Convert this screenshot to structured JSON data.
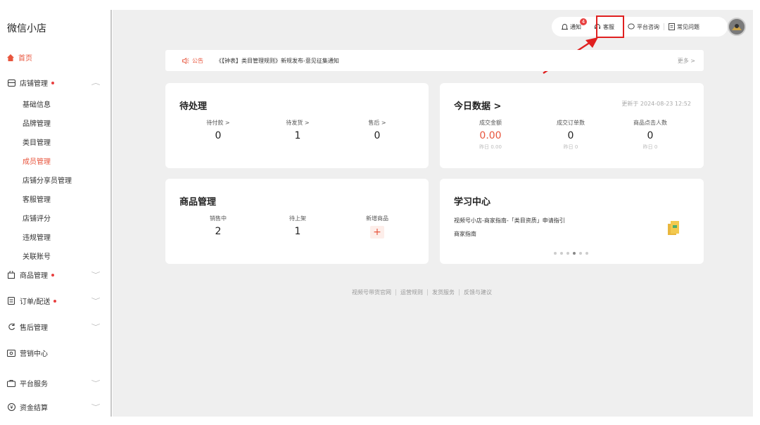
{
  "sidebar": {
    "brand": "微信小店",
    "home": "首页",
    "store_group": "店铺管理",
    "store_items": [
      "基础信息",
      "品牌管理",
      "类目管理",
      "成员管理",
      "店铺分享员管理",
      "客服管理",
      "店铺评分",
      "违规管理",
      "关联账号"
    ],
    "groups": {
      "goods": "商品管理",
      "orders": "订单/配送",
      "aftersale": "售后管理",
      "marketing": "营销中心",
      "platform": "平台服务",
      "finance": "资金结算"
    }
  },
  "topbar": {
    "notify": "通知",
    "notify_badge": "4",
    "service": "客服",
    "consult": "平台咨询",
    "faq": "常见问题"
  },
  "notice": {
    "label": "公告",
    "text": "《【钟表】类目管理规则》新规发布-意见征集通知",
    "more": "更多 >"
  },
  "pending": {
    "title": "待处理",
    "items": [
      {
        "label": "待付款 >",
        "value": "0"
      },
      {
        "label": "待发货 >",
        "value": "1"
      },
      {
        "label": "售后 >",
        "value": "0"
      }
    ]
  },
  "today": {
    "title": "今日数据 >",
    "updated": "更新于 2024-08-23 12:52",
    "items": [
      {
        "label": "成交金额",
        "value": "0.00",
        "sub": "昨日 0.00"
      },
      {
        "label": "成交订单数",
        "value": "0",
        "sub": "昨日 0"
      },
      {
        "label": "商品点击人数",
        "value": "0",
        "sub": "昨日 0"
      }
    ]
  },
  "goods": {
    "title": "商品管理",
    "items": [
      {
        "label": "销售中",
        "value": "2"
      },
      {
        "label": "待上架",
        "value": "1"
      },
      {
        "label": "新增商品",
        "value": "+"
      }
    ]
  },
  "learning": {
    "title": "学习中心",
    "line1": "视频号小店-商家指南-「类目资质」申请指引",
    "line2": "商家指南"
  },
  "footer": [
    "视频号带货官网",
    "运营规则",
    "发货服务",
    "反馈与建议"
  ],
  "colors": {
    "accent": "#e8553d",
    "highlight": "#e02020",
    "bg": "#efefef"
  }
}
